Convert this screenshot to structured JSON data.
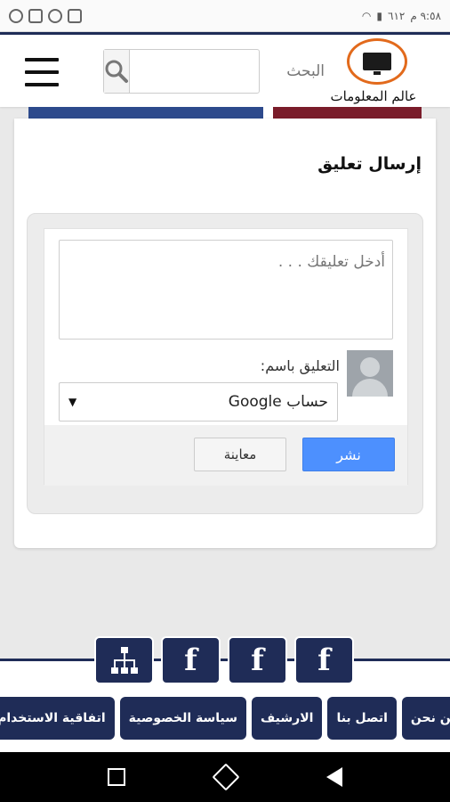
{
  "status_bar": {
    "time": "٩:٥٨ م",
    "battery": "٦١٢"
  },
  "header": {
    "search_placeholder": "البحث",
    "logo_text": "عالم المعلومات"
  },
  "comment_section": {
    "title": "إرسال تعليق",
    "textarea_placeholder": "أدخل تعليقك . . .",
    "comment_as_label": "التعليق باسم:",
    "selected_account": "Google حساب",
    "publish_button": "نشر",
    "preview_button": "معاينة"
  },
  "social": {
    "icons": [
      "sitemap-icon",
      "facebook-icon",
      "facebook-icon",
      "facebook-icon"
    ],
    "facebook_glyph": "f",
    "sitemap_glyph": "品"
  },
  "footer_links": [
    "من نحن",
    "اتصل بنا",
    "الارشيف",
    "سياسة الخصوصية",
    "اتفاقية الاستخدام"
  ],
  "colors": {
    "navy": "#1f2c57",
    "accent_orange": "#e26a1c",
    "publish_blue": "#4d90fe",
    "strip_blue": "#2d4a8c",
    "strip_red": "#7a1c2a"
  }
}
